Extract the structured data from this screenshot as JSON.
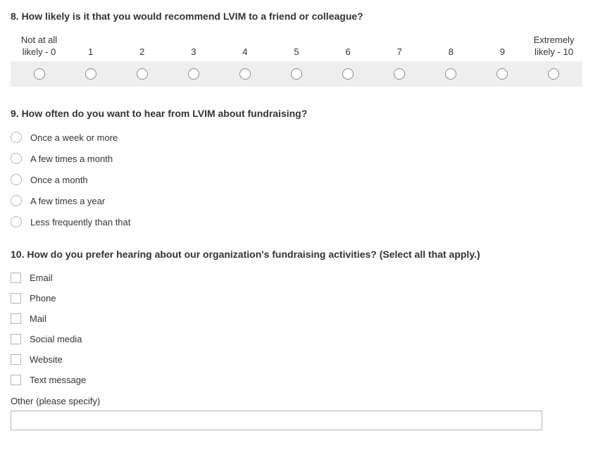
{
  "q8": {
    "title": "8. How likely is it that you would recommend LVIM to a friend or colleague?",
    "labels": {
      "l0": "Not at all likely - 0",
      "l1": "1",
      "l2": "2",
      "l3": "3",
      "l4": "4",
      "l5": "5",
      "l6": "6",
      "l7": "7",
      "l8": "8",
      "l9": "9",
      "l10": "Extremely likely - 10"
    }
  },
  "q9": {
    "title": "9. How often do you want to hear from LVIM about fundraising?",
    "options": {
      "o0": "Once a week or more",
      "o1": "A few times a month",
      "o2": "Once a month",
      "o3": "A few times a year",
      "o4": "Less frequently than that"
    }
  },
  "q10": {
    "title": "10. How do you prefer hearing about our organization's fundraising activities? (Select all that apply.)",
    "options": {
      "o0": "Email",
      "o1": "Phone",
      "o2": "Mail",
      "o3": "Social media",
      "o4": "Website",
      "o5": "Text message"
    },
    "other_label": "Other (please specify)",
    "other_value": ""
  }
}
